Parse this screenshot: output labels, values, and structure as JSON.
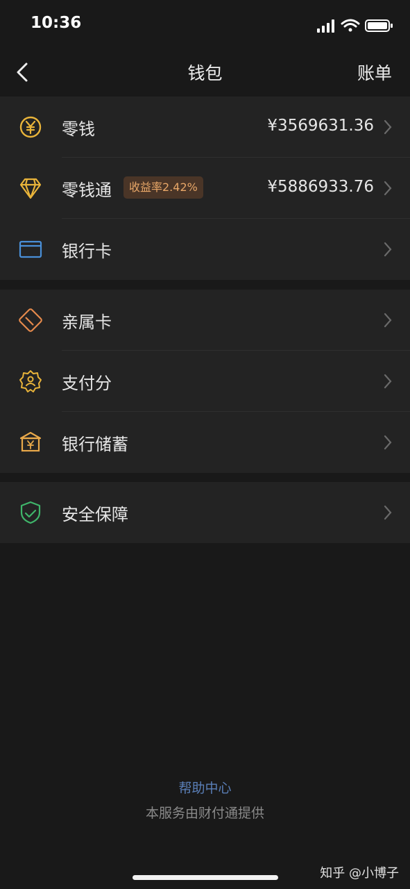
{
  "status_bar": {
    "time": "10:36"
  },
  "nav": {
    "title": "钱包",
    "bill_label": "账单"
  },
  "groups": [
    {
      "items": [
        {
          "label": "零钱",
          "amount": "¥3569631.36",
          "icon": "yen-coin-icon",
          "color": "#e9b43a"
        },
        {
          "label": "零钱通",
          "badge": "收益率2.42%",
          "amount": "¥5886933.76",
          "icon": "diamond-icon",
          "color": "#e9b43a"
        },
        {
          "label": "银行卡",
          "icon": "bank-card-icon",
          "color": "#4a90d9"
        }
      ]
    },
    {
      "items": [
        {
          "label": "亲属卡",
          "icon": "family-card-icon",
          "color": "#e58a4c"
        },
        {
          "label": "支付分",
          "icon": "pay-score-icon",
          "color": "#e9b43a"
        },
        {
          "label": "银行储蓄",
          "icon": "bank-savings-icon",
          "color": "#e9a94a"
        }
      ]
    },
    {
      "items": [
        {
          "label": "安全保障",
          "icon": "shield-icon",
          "color": "#3fb56a"
        }
      ]
    }
  ],
  "footer": {
    "help_link": "帮助中心",
    "provider_text": "本服务由财付通提供"
  },
  "watermark": "知乎 @小博子"
}
